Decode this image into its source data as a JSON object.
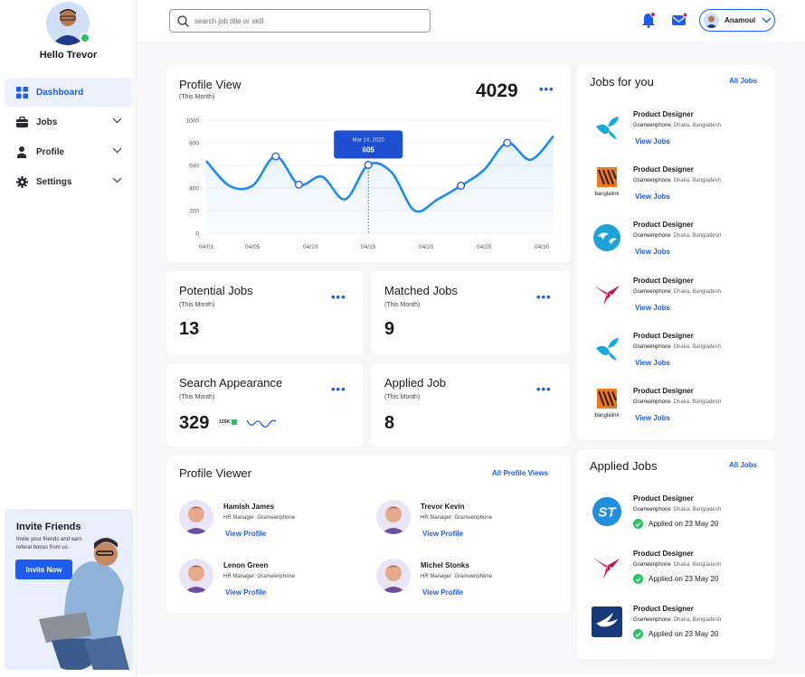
{
  "user": {
    "greeting": "Hello Trevor",
    "header_name": "Anamoul"
  },
  "sidebar": {
    "items": [
      {
        "label": "Dashboard",
        "icon": "dashboard-icon",
        "active": true
      },
      {
        "label": "Jobs",
        "icon": "briefcase-icon"
      },
      {
        "label": "Profile",
        "icon": "person-icon"
      },
      {
        "label": "Settings",
        "icon": "gear-icon"
      }
    ],
    "invite": {
      "title": "Invite Friends",
      "text": "Invite your friends and earn referal bonus from us.",
      "button": "Invite Now"
    }
  },
  "search": {
    "placeholder": "search job title or skill"
  },
  "colors": {
    "accent": "#1d5cf0",
    "success": "#22c55e",
    "notify": "#e11d48"
  },
  "profile_view": {
    "title": "Profile View",
    "subtitle": "(This Month)",
    "total": "4029"
  },
  "chart_data": {
    "type": "line",
    "title": "Profile View",
    "x": [
      "04/01",
      "04/03",
      "04/05",
      "04/07",
      "04/09",
      "04/11",
      "04/13",
      "04/15",
      "04/17",
      "04/19",
      "04/21",
      "04/23",
      "04/25",
      "04/27",
      "04/29",
      "05/01"
    ],
    "x_ticks": [
      "04/01",
      "04/05",
      "04/10",
      "04/15",
      "04/20",
      "04/25",
      "04/30"
    ],
    "y_ticks": [
      "0",
      "200",
      "400",
      "600",
      "800",
      "1000"
    ],
    "series": [
      {
        "values": [
          640,
          420,
          420,
          680,
          430,
          500,
          300,
          605,
          540,
          200,
          300,
          420,
          560,
          800,
          650,
          860
        ]
      }
    ],
    "marked_points": [
      3,
      4,
      7,
      11,
      13
    ],
    "ylim": [
      0,
      1000
    ],
    "grid": true,
    "tooltip": {
      "date": "Mar 14, 2020",
      "value": "605"
    }
  },
  "stats": {
    "potential": {
      "title": "Potential Jobs",
      "subtitle": "(This Month)",
      "value": "13"
    },
    "matched": {
      "title": "Matched Jobs",
      "subtitle": "(This Month)",
      "value": "9"
    },
    "search": {
      "title": "Search Appearance",
      "subtitle": "(This Month)",
      "value": "329",
      "badge": "125K"
    },
    "applied": {
      "title": "Applied Job",
      "subtitle": "(This Month)",
      "value": "8"
    }
  },
  "profile_viewer": {
    "title": "Profile Viewer",
    "link": "All Profile Views",
    "people": [
      {
        "name": "Hamish James",
        "role": "HR Manager",
        "company": "Grameenphone",
        "link": "View Profile"
      },
      {
        "name": "Trevor Kevin",
        "role": "HR Manager",
        "company": "Grameenphone",
        "link": "View Profile"
      },
      {
        "name": "Lenon  Green",
        "role": "HR Manager",
        "company": "Grameenphone",
        "link": "View Profile"
      },
      {
        "name": "Michel Stonks",
        "role": "HR Manager",
        "company": "Grameenphone",
        "link": "View Profile"
      }
    ]
  },
  "jobs_for_you": {
    "title": "Jobs for you",
    "link": "All Jobs",
    "jobs": [
      {
        "title": "Product Designer",
        "company": "Grameenphone",
        "location": "Dhaka, Bangladesh",
        "link": "View Jobs",
        "logo": "grameenphone-logo"
      },
      {
        "title": "Product Designer",
        "company": "Grameenphone",
        "location": "Dhaka, Bangladesh",
        "link": "View Jobs",
        "logo": "banglalink-logo",
        "logo_text": "banglalink"
      },
      {
        "title": "Product Designer",
        "company": "Grameenphone",
        "location": "Dhaka, Bangladesh",
        "link": "View Jobs",
        "logo": "globe-bird-logo"
      },
      {
        "title": "Product Designer",
        "company": "Grameenphone",
        "location": "Dhaka, Bangladesh",
        "link": "View Jobs",
        "logo": "origami-bird-logo"
      },
      {
        "title": "Product Designer",
        "company": "Grameenphone",
        "location": "Dhaka, Bangladesh",
        "link": "View Jobs",
        "logo": "grameenphone-logo"
      },
      {
        "title": "Product Designer",
        "company": "Grameenphone",
        "location": "Dhaka, Bangladesh",
        "link": "View Jobs",
        "logo": "banglalink-logo",
        "logo_text": "banglalink"
      }
    ]
  },
  "applied_jobs": {
    "title": "Applied Jobs",
    "link": "All Jobs",
    "jobs": [
      {
        "title": "Product Designer",
        "company": "Grameenphone",
        "location": "Dhaka, Bangladesh",
        "status": "Applied on 23 May 20",
        "logo": "st-logo",
        "logo_text": "ST"
      },
      {
        "title": "Product Designer",
        "company": "Grameenphone",
        "location": "Dhaka, Bangladesh",
        "status": "Applied on 23 May 20",
        "logo": "origami-bird-logo"
      },
      {
        "title": "Product Designer",
        "company": "Grameenphone",
        "location": "Dhaka, Bangladesh",
        "status": "Applied on 23 May 20",
        "logo": "bird-square-logo"
      }
    ]
  }
}
